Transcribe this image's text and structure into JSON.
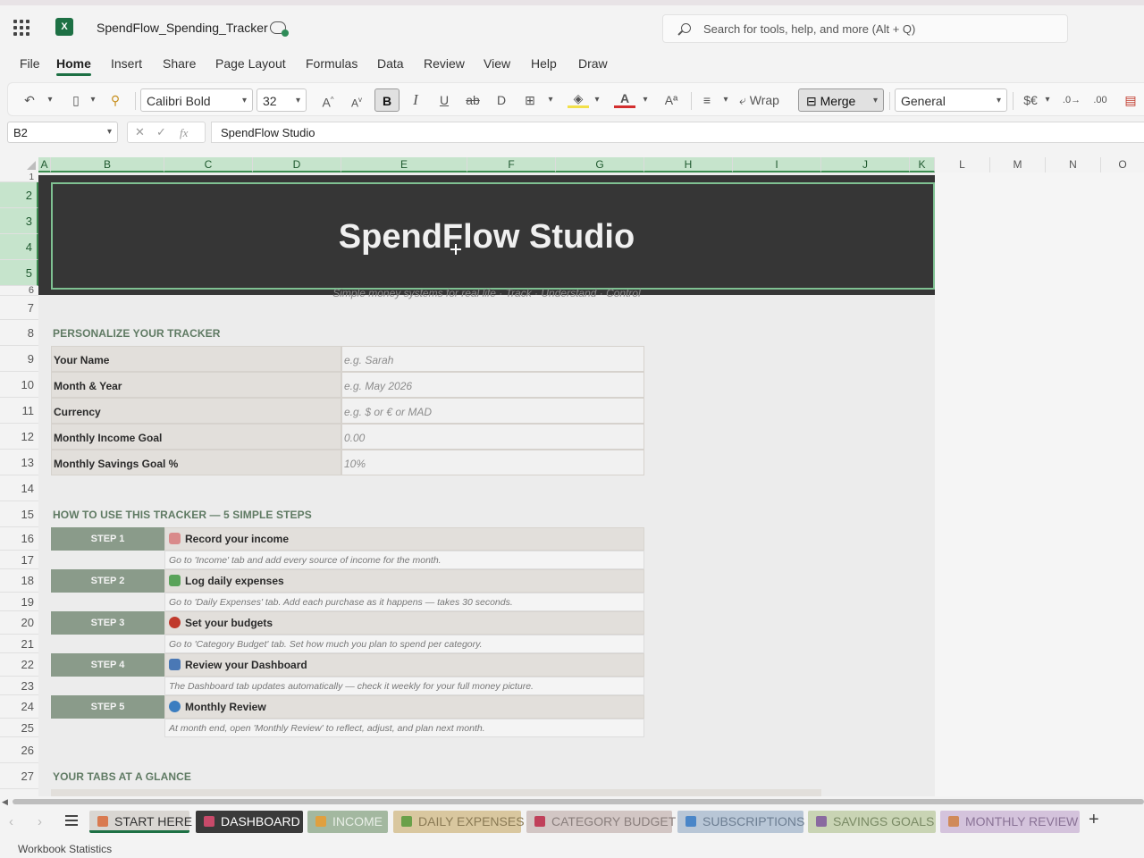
{
  "app": {
    "doc_title": "SpendFlow_Spending_Tracker",
    "search_placeholder": "Search for tools, help, and more (Alt + Q)"
  },
  "menu": [
    "File",
    "Home",
    "Insert",
    "Share",
    "Page Layout",
    "Formulas",
    "Data",
    "Review",
    "View",
    "Help",
    "Draw"
  ],
  "menu_active": "Home",
  "ribbon": {
    "font_name": "Calibri Bold",
    "font_size": "32",
    "grow_font": "A",
    "shrink_font": "A",
    "bold": "B",
    "italic": "I",
    "underline": "U",
    "strike": "ab",
    "wrap_label": "Wrap",
    "merge_label": "Merge",
    "number_format": "General",
    "currency": "$€"
  },
  "formula_bar": {
    "name_box": "B2",
    "fx": "fx",
    "formula": "SpendFlow Studio"
  },
  "columns": [
    "A",
    "B",
    "C",
    "D",
    "E",
    "F",
    "G",
    "H",
    "I",
    "J",
    "K",
    "L",
    "M",
    "N",
    "O"
  ],
  "rows": [
    "1",
    "2",
    "3",
    "4",
    "5",
    "6",
    "7",
    "8",
    "9",
    "10",
    "11",
    "12",
    "13",
    "14",
    "15",
    "16",
    "17",
    "18",
    "19",
    "20",
    "21",
    "22",
    "23",
    "24",
    "25",
    "26",
    "27"
  ],
  "banner": {
    "title": "SpendFlow Studio",
    "subtitle": "Simple money systems for real life  ·  Track  ·  Understand  ·  Control"
  },
  "personalize": {
    "heading": "PERSONALIZE YOUR TRACKER",
    "fields": [
      {
        "label": "Your Name",
        "value": "e.g. Sarah"
      },
      {
        "label": "Month & Year",
        "value": "e.g. May 2026"
      },
      {
        "label": "Currency",
        "value": "e.g. $ or € or MAD"
      },
      {
        "label": "Monthly Income Goal",
        "value": "0.00"
      },
      {
        "label": "Monthly Savings Goal %",
        "value": "10%"
      }
    ]
  },
  "howto": {
    "heading": "HOW TO USE THIS TRACKER — 5 SIMPLE STEPS",
    "steps": [
      {
        "badge": "STEP 1",
        "title": "Record your income",
        "desc": "Go to 'Income' tab and add every source of income for the month.",
        "icon": "money-bag-icon",
        "icon_color": "#d98a8a"
      },
      {
        "badge": "STEP 2",
        "title": "Log daily expenses",
        "desc": "Go to 'Daily Expenses' tab. Add each purchase as it happens — takes 30 seconds.",
        "icon": "cash-icon",
        "icon_color": "#5aa35a"
      },
      {
        "badge": "STEP 3",
        "title": "Set your budgets",
        "desc": "Go to 'Category Budget' tab. Set how much you plan to spend per category.",
        "icon": "target-icon",
        "icon_color": "#c0392b"
      },
      {
        "badge": "STEP 4",
        "title": "Review your Dashboard",
        "desc": "The Dashboard tab updates automatically — check it weekly for your full money picture.",
        "icon": "bar-chart-icon",
        "icon_color": "#4a78b5"
      },
      {
        "badge": "STEP 5",
        "title": "Monthly Review",
        "desc": "At month end, open 'Monthly Review' to reflect, adjust, and plan next month.",
        "icon": "magnifier-icon",
        "icon_color": "#3b7dc0"
      }
    ]
  },
  "tabs_glance": {
    "heading": "YOUR TABS AT A GLANCE"
  },
  "sheet_tabs": [
    {
      "label": "START HERE",
      "bg": "#d9d6d2",
      "color": "#333333",
      "icon_color": "#d97a50",
      "active": true
    },
    {
      "label": "DASHBOARD",
      "bg": "#3a3a3a",
      "color": "#ffffff",
      "icon_color": "#c84a6a",
      "active": false
    },
    {
      "label": "INCOME",
      "bg": "#a3b8a0",
      "color": "#e9efe7",
      "icon_color": "#e0a040",
      "active": false
    },
    {
      "label": "DAILY EXPENSES",
      "bg": "#d9c79f",
      "color": "#8a7a55",
      "icon_color": "#6aa04a",
      "active": false
    },
    {
      "label": "CATEGORY BUDGET",
      "bg": "#d2c6c4",
      "color": "#8a7f7d",
      "icon_color": "#c0405a",
      "active": false
    },
    {
      "label": "SUBSCRIPTIONS",
      "bg": "#b8c6d6",
      "color": "#6d7e92",
      "icon_color": "#4a86c8",
      "active": false
    },
    {
      "label": "SAVINGS GOALS",
      "bg": "#c9d4b4",
      "color": "#7a8a65",
      "icon_color": "#8a6aa0",
      "active": false
    },
    {
      "label": "MONTHLY REVIEW",
      "bg": "#d4c3dc",
      "color": "#8a7396",
      "icon_color": "#d08a5a",
      "active": false
    }
  ],
  "status": {
    "text": "Workbook Statistics"
  },
  "colors": {
    "excel_green": "#1d7044",
    "banner_bg": "#363636",
    "section_heading": "#5f7a63",
    "step_badge": "#8a9b8a"
  }
}
